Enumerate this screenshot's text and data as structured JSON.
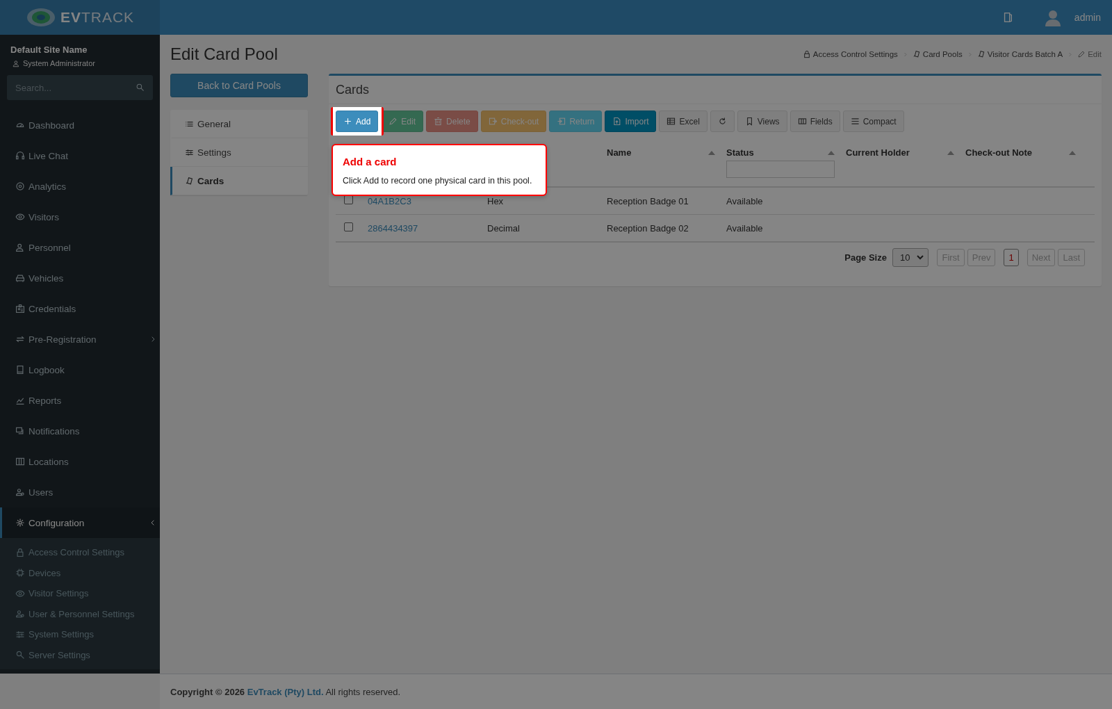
{
  "header": {
    "logo": "**EV**TRACK",
    "user": "admin"
  },
  "sidebar": {
    "site_name": "Default Site Name",
    "role": "System Administrator",
    "search": {
      "placeholder": "Search..."
    },
    "items": [
      {
        "label": "Dashboard",
        "selected": false
      },
      {
        "label": "Live Chat",
        "selected": false
      },
      {
        "label": "Analytics",
        "selected": false
      },
      {
        "label": "Visitors",
        "selected": false
      },
      {
        "label": "Personnel",
        "selected": false
      },
      {
        "label": "Vehicles",
        "selected": false
      },
      {
        "label": "Credentials",
        "selected": false
      },
      {
        "label": "Pre-Registration",
        "selected": false,
        "expanded": false
      },
      {
        "label": "Logbook",
        "selected": false
      },
      {
        "label": "Reports",
        "selected": false
      },
      {
        "label": "Notifications",
        "selected": false
      },
      {
        "label": "Locations",
        "selected": false
      },
      {
        "label": "Users",
        "selected": false
      },
      {
        "label": "Configuration",
        "selected": true,
        "expanded": true,
        "children": [
          {
            "label": "Access Control Settings",
            "selected": false
          },
          {
            "label": "Devices",
            "selected": false
          },
          {
            "label": "Visitor Settings",
            "selected": false
          },
          {
            "label": "User & Personnel Settings",
            "selected": false
          },
          {
            "label": "System Settings",
            "selected": false
          },
          {
            "label": "Server Settings",
            "selected": false
          }
        ]
      }
    ]
  },
  "page": {
    "title": "Edit Card Pool",
    "breadcrumb": [
      "Access Control Settings",
      "Card Pools",
      "Visitor Cards Batch A",
      "Edit"
    ],
    "back_button": "Back to Card Pools",
    "tabs": [
      {
        "label": "General",
        "selected": false
      },
      {
        "label": "Settings",
        "selected": false
      },
      {
        "label": "Cards",
        "selected": true
      }
    ]
  },
  "cards_panel": {
    "title": "Cards",
    "toolbar": [
      {
        "label": "Add",
        "kind": "primary",
        "disabled": false
      },
      {
        "label": "Edit",
        "kind": "success",
        "disabled": true
      },
      {
        "label": "Delete",
        "kind": "danger",
        "disabled": true
      },
      {
        "label": "Check-out",
        "kind": "warning",
        "disabled": true
      },
      {
        "label": "Return",
        "kind": "info",
        "disabled": true
      },
      {
        "label": "Import",
        "kind": "import",
        "disabled": false
      },
      {
        "label": "Excel",
        "kind": "default",
        "disabled": false
      },
      {
        "kind": "refresh",
        "disabled": false
      },
      {
        "label": "Views",
        "kind": "default",
        "disabled": false
      },
      {
        "label": "Fields",
        "kind": "default",
        "disabled": false
      },
      {
        "label": "Compact",
        "kind": "default",
        "disabled": false
      }
    ],
    "table": {
      "columns": [
        {
          "label": "Name"
        },
        {
          "label": "Status",
          "filter": true
        },
        {
          "label": "Current Holder"
        },
        {
          "label": "Check-out Note"
        }
      ],
      "rows": [
        {
          "checked": false,
          "column_2": "04A1B2C3",
          "column_3": "Hex",
          "name": "Reception Badge 01",
          "status": "Available"
        },
        {
          "checked": false,
          "column_2": "2864434397",
          "column_3": "Decimal",
          "name": "Reception Badge 02",
          "status": "Available"
        }
      ]
    },
    "pager": {
      "label": "Page Size",
      "page_size": "10",
      "buttons": [
        {
          "label": "First",
          "disabled": true,
          "selected": false
        },
        {
          "label": "Prev",
          "disabled": true,
          "selected": false
        },
        {
          "label": "1",
          "disabled": false,
          "selected": true
        },
        {
          "label": "Next",
          "disabled": true,
          "selected": false
        },
        {
          "label": "Last",
          "disabled": true,
          "selected": false
        }
      ]
    }
  },
  "tour": {
    "title": "Add a card",
    "text": "Click Add to record one physical card in this pool."
  },
  "footer": {
    "text": "Copyright © 2026 ",
    "link": "EvTrack (Pty) Ltd.",
    "suffix": " All rights reserved."
  }
}
